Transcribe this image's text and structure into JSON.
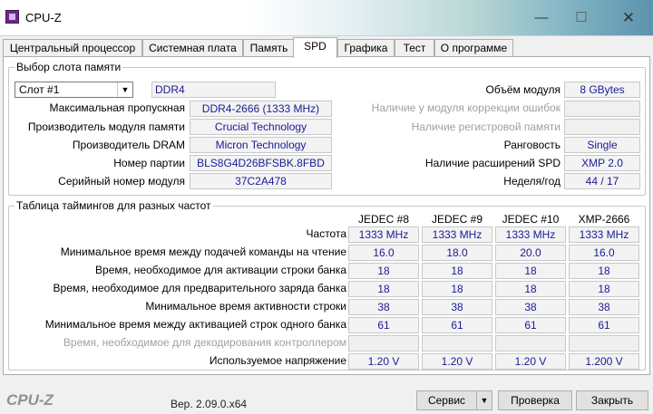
{
  "window": {
    "title": "CPU-Z",
    "minimize_glyph": "—",
    "maximize_glyph": "☐",
    "close_glyph": "✕"
  },
  "tabs": [
    {
      "label": "Центральный процессор",
      "active": false
    },
    {
      "label": "Системная плата",
      "active": false
    },
    {
      "label": "Память",
      "active": false
    },
    {
      "label": "SPD",
      "active": true
    },
    {
      "label": "Графика",
      "active": false
    },
    {
      "label": "Тест",
      "active": false
    },
    {
      "label": "О программе",
      "active": false
    }
  ],
  "slot_section": {
    "title": "Выбор слота памяти",
    "slot_select": {
      "value": "Слот #1",
      "arrow_glyph": "▼"
    },
    "memory_type": "DDR4",
    "max_bandwidth_label": "Максимальная пропускная",
    "max_bandwidth": "DDR4-2666 (1333 MHz)",
    "module_manufacturer_label": "Производитель модуля памяти",
    "module_manufacturer": "Crucial Technology",
    "dram_manufacturer_label": "Производитель DRAM",
    "dram_manufacturer": "Micron Technology",
    "part_number_label": "Номер партии",
    "part_number": "BLS8G4D26BFSBK.8FBD",
    "serial_number_label": "Серийный номер модуля",
    "serial_number": "37C2A478",
    "module_size_label": "Объём модуля",
    "module_size": "8 GBytes",
    "ecc_label": "Наличие у модуля коррекции ошибок",
    "ecc": "",
    "registered_label": "Наличие регистровой памяти",
    "registered": "",
    "ranks_label": "Ранговость",
    "ranks": "Single",
    "spd_ext_label": "Наличие расширений SPD",
    "spd_ext": "XMP 2.0",
    "week_year_label": "Неделя/год",
    "week_year": "44 / 17"
  },
  "timings_section": {
    "title": "Таблица таймингов для разных частот",
    "columns": [
      "JEDEC #8",
      "JEDEC #9",
      "JEDEC #10",
      "XMP-2666"
    ],
    "rows": [
      {
        "label": "Частота",
        "values": [
          "1333 MHz",
          "1333 MHz",
          "1333 MHz",
          "1333 MHz"
        ],
        "disabled": false
      },
      {
        "label": "Минимальное время между подачей команды на чтение",
        "values": [
          "16.0",
          "18.0",
          "20.0",
          "16.0"
        ],
        "disabled": false
      },
      {
        "label": "Время, необходимое для активации строки банка",
        "values": [
          "18",
          "18",
          "18",
          "18"
        ],
        "disabled": false
      },
      {
        "label": "Время, необходимое для предварительного заряда банка",
        "values": [
          "18",
          "18",
          "18",
          "18"
        ],
        "disabled": false
      },
      {
        "label": "Минимальное время активности строки",
        "values": [
          "38",
          "38",
          "38",
          "38"
        ],
        "disabled": false
      },
      {
        "label": "Минимальное время между активацией строк одного банка",
        "values": [
          "61",
          "61",
          "61",
          "61"
        ],
        "disabled": false
      },
      {
        "label": "Время, необходимое для декодирования контроллером",
        "values": [
          "",
          "",
          "",
          ""
        ],
        "disabled": true
      },
      {
        "label": "Используемое напряжение",
        "values": [
          "1.20 V",
          "1.20 V",
          "1.20 V",
          "1.200 V"
        ],
        "disabled": false
      }
    ]
  },
  "footer": {
    "logo": "CPU-Z",
    "version": "Вер. 2.09.0.x64",
    "service_button": "Сервис",
    "service_arrow": "▼",
    "validate_button": "Проверка",
    "close_button": "Закрыть"
  }
}
